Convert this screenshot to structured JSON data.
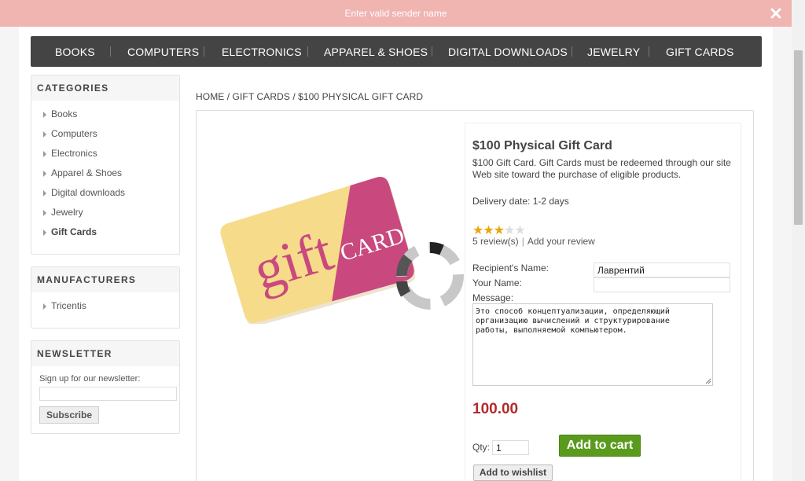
{
  "notification": {
    "text": "Enter valid sender name",
    "close_icon": "close-icon"
  },
  "topmenu": [
    "BOOKS",
    "COMPUTERS",
    "ELECTRONICS",
    "APPAREL & SHOES",
    "DIGITAL DOWNLOADS",
    "JEWELRY",
    "GIFT CARDS"
  ],
  "categories": {
    "title": "CATEGORIES",
    "items": [
      "Books",
      "Computers",
      "Electronics",
      "Apparel & Shoes",
      "Digital downloads",
      "Jewelry",
      "Gift Cards"
    ],
    "active": "Gift Cards"
  },
  "manufacturers": {
    "title": "MANUFACTURERS",
    "items": [
      "Tricentis"
    ]
  },
  "newsletter": {
    "title": "NEWSLETTER",
    "label": "Sign up for our newsletter:",
    "button": "Subscribe",
    "email_value": ""
  },
  "breadcrumb": {
    "home": "HOME",
    "sep": "/",
    "category": "GIFT CARDS",
    "current": "$100 PHYSICAL GIFT CARD"
  },
  "product": {
    "name": "$100 Physical Gift Card",
    "description": "$100 Gift Card. Gift Cards must be redeemed through our site Web site toward the purchase of eligible products.",
    "delivery": "Delivery date: 1-2 days",
    "rating": 3,
    "rating_max": 5,
    "reviews_link": "5 review(s)",
    "add_review_link": "Add your review",
    "image_text_main": "gift",
    "image_text_side": "CARD",
    "price": "100.00"
  },
  "form": {
    "recipient_label": "Recipient's Name:",
    "recipient_value": "Лаврентий",
    "sender_label": "Your Name:",
    "sender_value": "",
    "message_label": "Message:",
    "message_value": "Это способ концептуализации, определяющий\nорганизацию вычислений и структурирование\nработы, выполняемой компьютером.",
    "qty_label": "Qty:",
    "qty_value": "1",
    "add_to_cart": "Add to cart",
    "add_to_wishlist": "Add to wishlist"
  },
  "colors": {
    "accent_price": "#b12b2b",
    "cart_button": "#5a9b1d",
    "notification": "#f0b4b1",
    "menu_bg": "#444444",
    "star": "#e8a70f"
  }
}
